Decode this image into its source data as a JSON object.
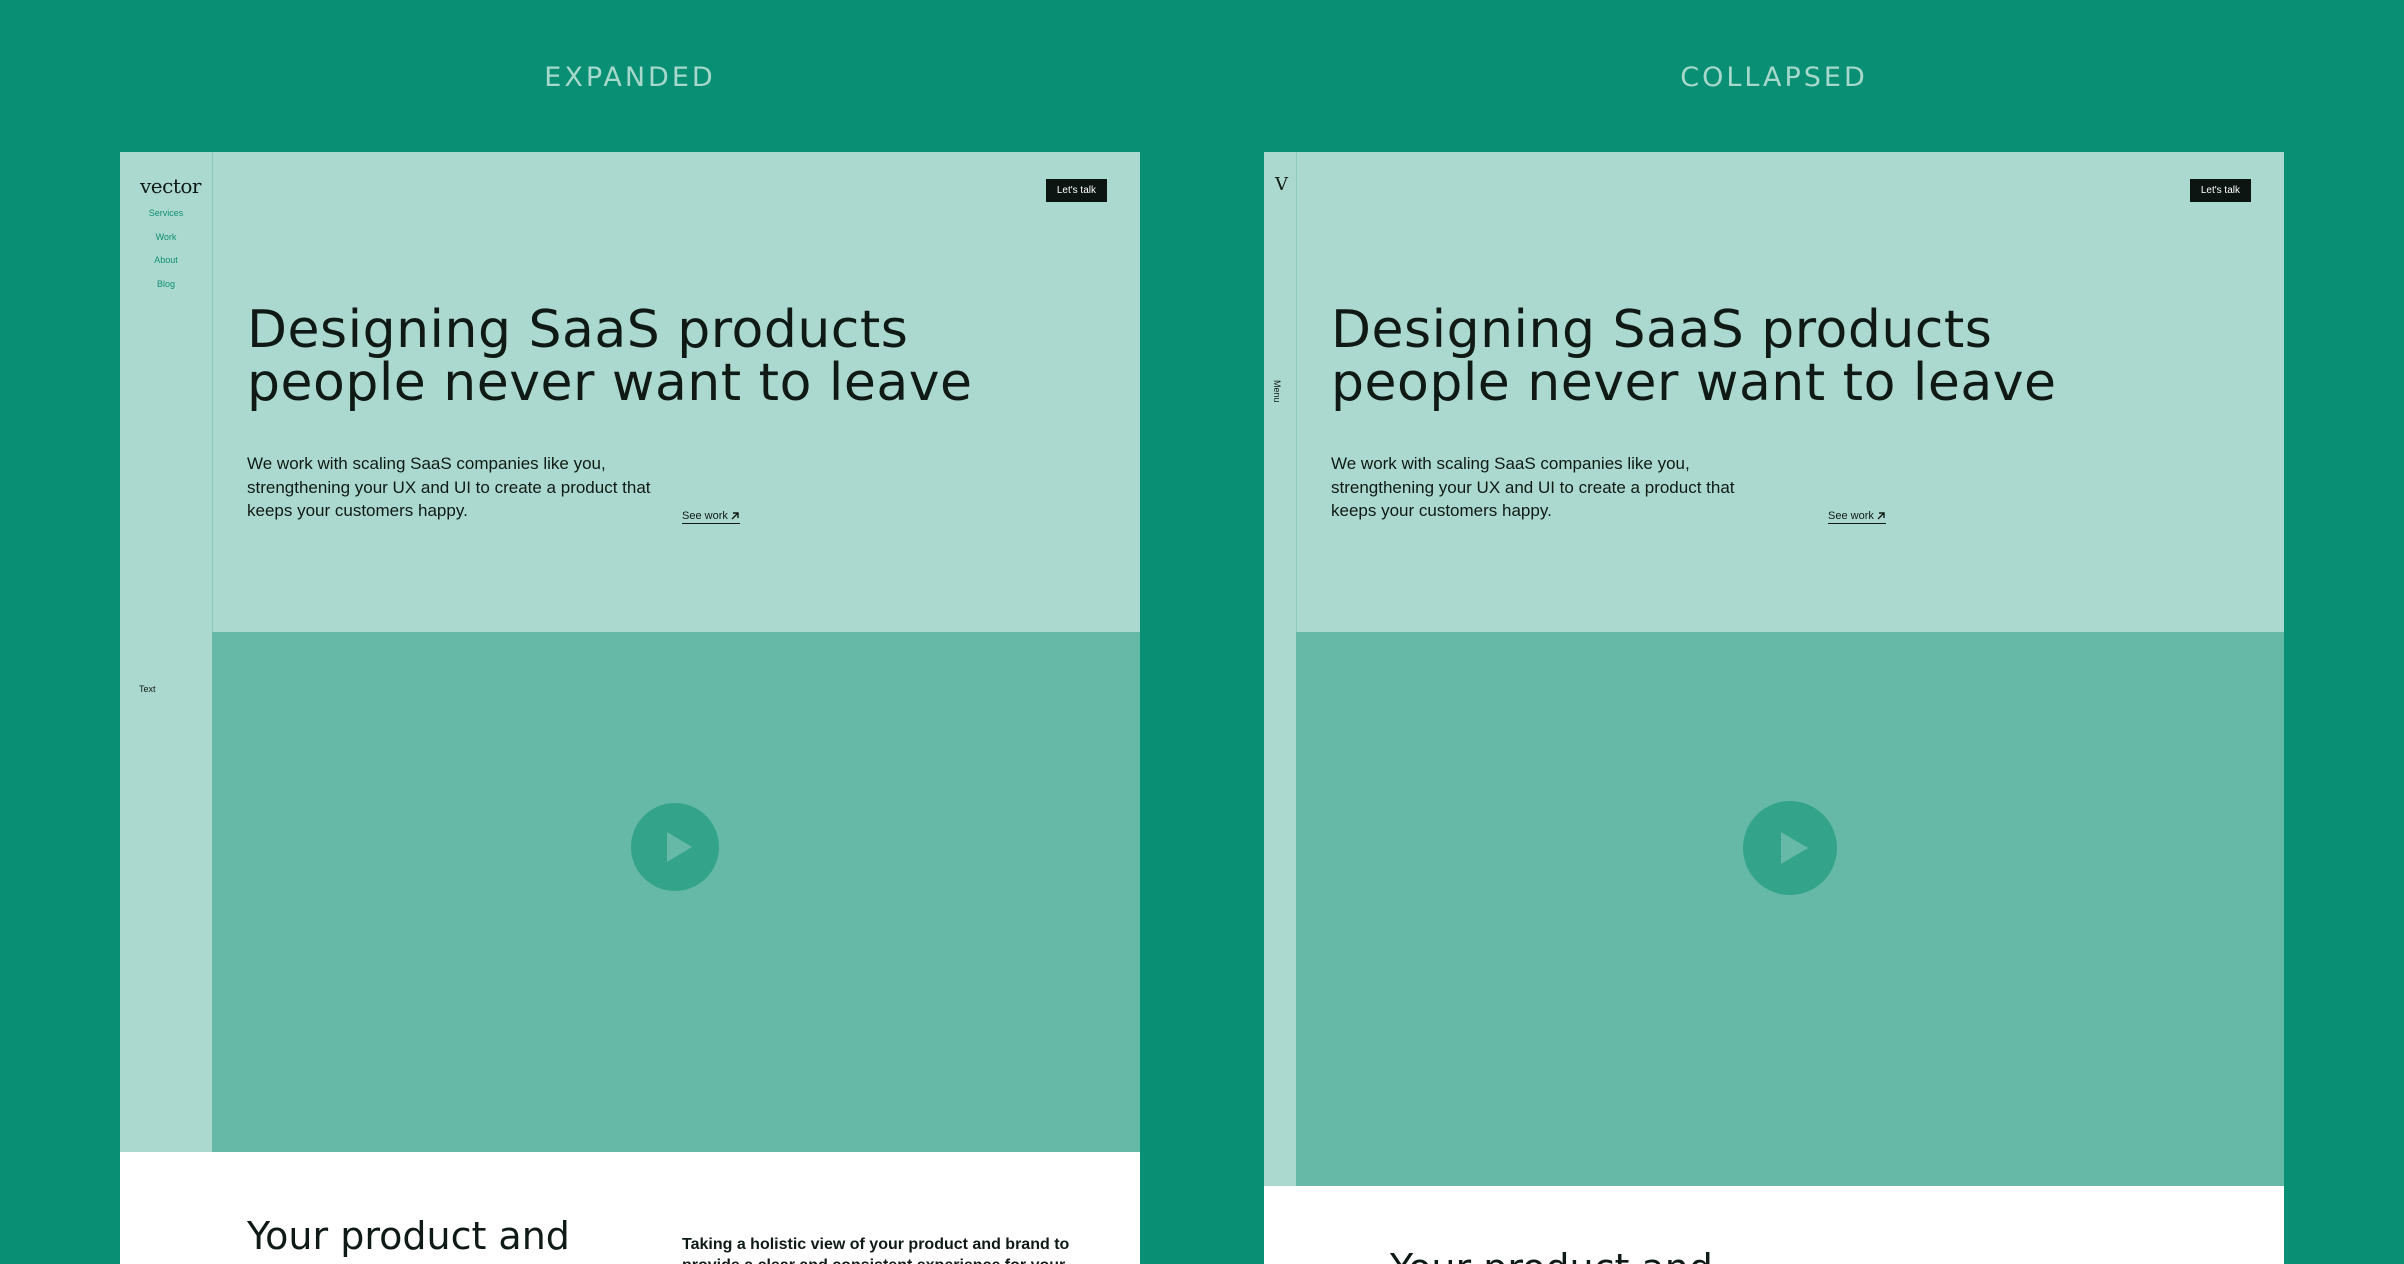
{
  "labels": {
    "expanded": "EXPANDED",
    "collapsed": "COLLAPSED"
  },
  "expanded": {
    "logo": "vector",
    "nav": [
      "Services",
      "Work",
      "About",
      "Blog"
    ],
    "side_text": "Text"
  },
  "collapsed": {
    "logo": "V",
    "menu_label": "Menu"
  },
  "hero": {
    "cta": "Let's talk",
    "title_line1": "Designing SaaS products",
    "title_line2": "people never want to leave",
    "description": "We work with scaling SaaS companies like you, strengthening your UX and UI to create a product that keeps your customers happy.",
    "see_work": "See work"
  },
  "section": {
    "title": "Your product and",
    "text": "Taking a holistic view of your product and brand to provide a clear and consistent experience for your"
  },
  "colors": {
    "background": "#098f73",
    "panel": "#acd9cf",
    "video": "#65b9a6",
    "play": "#33a489",
    "cta": "#0c1512"
  }
}
